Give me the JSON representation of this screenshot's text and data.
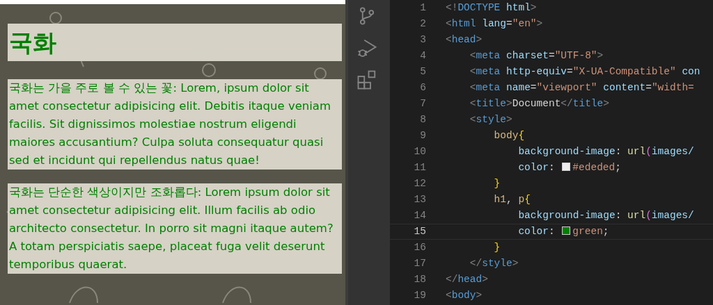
{
  "preview": {
    "heading": "국화",
    "paragraphs": [
      "국화는 가을 주로 볼 수 있는 꽃: Lorem, ipsum dolor sit amet consectetur adipisicing elit. Debitis itaque veniam facilis. Sit dignissimos molestiae nostrum eligendi maiores accusantium? Culpa soluta consequatur quasi sed et incidunt qui repellendus natus quae!",
      "국화는 단순한 색상이지만 조화롭다: Lorem ipsum dolor sit amet consectetur adipisicing elit. Illum facilis ab odio architecto consectetur. In porro sit magni itaque autem? A totam perspiciatis saepe, placeat fuga velit deserunt temporibus quaerat."
    ]
  },
  "editor": {
    "lines": [
      {
        "number": "1",
        "current": false,
        "tokens": [
          {
            "kind": "punct",
            "text": "<!"
          },
          {
            "kind": "tag",
            "text": "DOCTYPE"
          },
          {
            "kind": "attr",
            "text": " html"
          },
          {
            "kind": "punct",
            "text": ">"
          }
        ]
      },
      {
        "number": "2",
        "current": false,
        "tokens": [
          {
            "kind": "punct",
            "text": "<"
          },
          {
            "kind": "tag",
            "text": "html"
          },
          {
            "kind": "attr",
            "text": " lang"
          },
          {
            "kind": "text",
            "text": "="
          },
          {
            "kind": "string",
            "text": "\"en\""
          },
          {
            "kind": "punct",
            "text": ">"
          }
        ]
      },
      {
        "number": "3",
        "current": false,
        "tokens": [
          {
            "kind": "punct",
            "text": "<"
          },
          {
            "kind": "tag",
            "text": "head"
          },
          {
            "kind": "punct",
            "text": ">"
          }
        ]
      },
      {
        "number": "4",
        "current": false,
        "tokens": [
          {
            "kind": "punct",
            "text": "    <"
          },
          {
            "kind": "tag",
            "text": "meta"
          },
          {
            "kind": "attr",
            "text": " charset"
          },
          {
            "kind": "text",
            "text": "="
          },
          {
            "kind": "string",
            "text": "\"UTF-8\""
          },
          {
            "kind": "punct",
            "text": ">"
          }
        ]
      },
      {
        "number": "5",
        "current": false,
        "tokens": [
          {
            "kind": "punct",
            "text": "    <"
          },
          {
            "kind": "tag",
            "text": "meta"
          },
          {
            "kind": "attr",
            "text": " http-equiv"
          },
          {
            "kind": "text",
            "text": "="
          },
          {
            "kind": "string",
            "text": "\"X-UA-Compatible\""
          },
          {
            "kind": "attr",
            "text": " con"
          }
        ]
      },
      {
        "number": "6",
        "current": false,
        "tokens": [
          {
            "kind": "punct",
            "text": "    <"
          },
          {
            "kind": "tag",
            "text": "meta"
          },
          {
            "kind": "attr",
            "text": " name"
          },
          {
            "kind": "text",
            "text": "="
          },
          {
            "kind": "string",
            "text": "\"viewport\""
          },
          {
            "kind": "attr",
            "text": " content"
          },
          {
            "kind": "text",
            "text": "="
          },
          {
            "kind": "string",
            "text": "\"width="
          }
        ]
      },
      {
        "number": "7",
        "current": false,
        "tokens": [
          {
            "kind": "punct",
            "text": "    <"
          },
          {
            "kind": "tag",
            "text": "title"
          },
          {
            "kind": "punct",
            "text": ">"
          },
          {
            "kind": "text",
            "text": "Document"
          },
          {
            "kind": "punct",
            "text": "</"
          },
          {
            "kind": "tag",
            "text": "title"
          },
          {
            "kind": "punct",
            "text": ">"
          }
        ]
      },
      {
        "number": "8",
        "current": false,
        "tokens": [
          {
            "kind": "punct",
            "text": "    <"
          },
          {
            "kind": "tag",
            "text": "style"
          },
          {
            "kind": "punct",
            "text": ">"
          }
        ]
      },
      {
        "number": "9",
        "current": false,
        "tokens": [
          {
            "kind": "selector",
            "text": "        body"
          },
          {
            "kind": "brace",
            "text": "{"
          }
        ]
      },
      {
        "number": "10",
        "current": false,
        "tokens": [
          {
            "kind": "prop",
            "text": "            background-image"
          },
          {
            "kind": "text",
            "text": ": "
          },
          {
            "kind": "func",
            "text": "url"
          },
          {
            "kind": "paren",
            "text": "("
          },
          {
            "kind": "prop",
            "text": "images/"
          }
        ]
      },
      {
        "number": "11",
        "current": false,
        "tokens": [
          {
            "kind": "prop",
            "text": "            color"
          },
          {
            "kind": "text",
            "text": ": "
          },
          {
            "kind": "swatch",
            "color": "#ededed"
          },
          {
            "kind": "value",
            "text": "#ededed"
          },
          {
            "kind": "text",
            "text": ";"
          }
        ]
      },
      {
        "number": "12",
        "current": false,
        "tokens": [
          {
            "kind": "brace",
            "text": "        }"
          }
        ]
      },
      {
        "number": "13",
        "current": false,
        "tokens": [
          {
            "kind": "selector",
            "text": "        h1"
          },
          {
            "kind": "text",
            "text": ", "
          },
          {
            "kind": "selector",
            "text": "p"
          },
          {
            "kind": "brace",
            "text": "{"
          }
        ]
      },
      {
        "number": "14",
        "current": false,
        "tokens": [
          {
            "kind": "prop",
            "text": "            background-image"
          },
          {
            "kind": "text",
            "text": ": "
          },
          {
            "kind": "func",
            "text": "url"
          },
          {
            "kind": "paren",
            "text": "("
          },
          {
            "kind": "prop",
            "text": "images/"
          }
        ]
      },
      {
        "number": "15",
        "current": true,
        "tokens": [
          {
            "kind": "prop",
            "text": "            color"
          },
          {
            "kind": "text",
            "text": ": "
          },
          {
            "kind": "swatch",
            "color": "#008000"
          },
          {
            "kind": "value",
            "text": "green"
          },
          {
            "kind": "text",
            "text": ";"
          }
        ]
      },
      {
        "number": "16",
        "current": false,
        "tokens": [
          {
            "kind": "brace",
            "text": "        }"
          }
        ]
      },
      {
        "number": "17",
        "current": false,
        "tokens": [
          {
            "kind": "punct",
            "text": "    </"
          },
          {
            "kind": "tag",
            "text": "style"
          },
          {
            "kind": "punct",
            "text": ">"
          }
        ]
      },
      {
        "number": "18",
        "current": false,
        "tokens": [
          {
            "kind": "punct",
            "text": "</"
          },
          {
            "kind": "tag",
            "text": "head"
          },
          {
            "kind": "punct",
            "text": ">"
          }
        ]
      },
      {
        "number": "19",
        "current": false,
        "tokens": [
          {
            "kind": "punct",
            "text": "<"
          },
          {
            "kind": "tag",
            "text": "body"
          },
          {
            "kind": "punct",
            "text": ">"
          }
        ]
      }
    ]
  }
}
